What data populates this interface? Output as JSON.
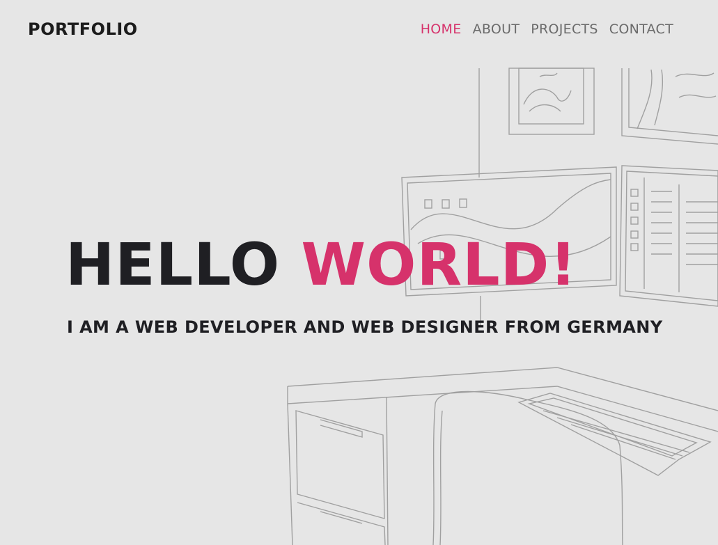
{
  "header": {
    "logo": "PORTFOLIO",
    "nav": [
      {
        "label": "HOME",
        "active": true
      },
      {
        "label": "ABOUT",
        "active": false
      },
      {
        "label": "PROJECTS",
        "active": false
      },
      {
        "label": "CONTACT",
        "active": false
      }
    ]
  },
  "hero": {
    "title_part1": "HELLO",
    "title_part2": "WORLD!",
    "subtitle": "I AM A WEB DEVELOPER AND WEB DESIGNER FROM GERMANY"
  },
  "colors": {
    "background": "#e6e6e6",
    "accent": "#d6326b",
    "text_dark": "#1f1f23",
    "nav_text": "#6a6a6a",
    "sketch_line": "#9a9a9a"
  },
  "background_image": {
    "icon": "desk-workspace-sketch-illustration"
  }
}
